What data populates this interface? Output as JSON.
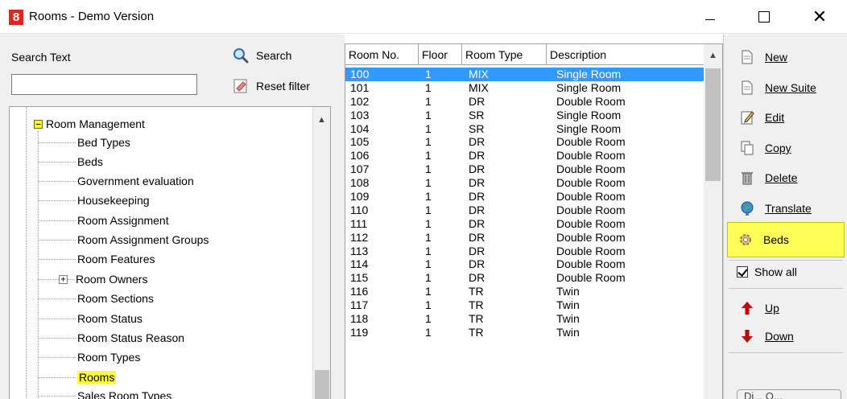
{
  "window": {
    "icon_text": "8",
    "title": "Rooms - Demo Version",
    "controls": {
      "minimize": "minimize",
      "maximize": "maximize",
      "close": "✕"
    }
  },
  "search": {
    "label": "Search Text",
    "value": "",
    "search_button": "Search",
    "reset_button": "Reset filter"
  },
  "tree": {
    "root": "Room Management",
    "root_expander": "−",
    "items": [
      {
        "label": "Bed Types"
      },
      {
        "label": "Beds"
      },
      {
        "label": "Government evaluation"
      },
      {
        "label": "Housekeeping"
      },
      {
        "label": "Room Assignment"
      },
      {
        "label": "Room Assignment Groups"
      },
      {
        "label": "Room Features"
      },
      {
        "label": "Room Owners",
        "expander": "+"
      },
      {
        "label": "Room Sections"
      },
      {
        "label": "Room Status"
      },
      {
        "label": "Room Status Reason"
      },
      {
        "label": "Room Types"
      },
      {
        "label": "Rooms",
        "selected": true
      },
      {
        "label": "Sales Room Types"
      }
    ]
  },
  "grid": {
    "columns": [
      "Room No.",
      "Floor",
      "Room Type",
      "Description"
    ],
    "rows": [
      [
        "100",
        "1",
        "MIX",
        "Single Room"
      ],
      [
        "101",
        "1",
        "MIX",
        "Single Room"
      ],
      [
        "102",
        "1",
        "DR",
        "Double Room"
      ],
      [
        "103",
        "1",
        "SR",
        "Single Room"
      ],
      [
        "104",
        "1",
        "SR",
        "Single Room"
      ],
      [
        "105",
        "1",
        "DR",
        "Double Room"
      ],
      [
        "106",
        "1",
        "DR",
        "Double Room"
      ],
      [
        "107",
        "1",
        "DR",
        "Double Room"
      ],
      [
        "108",
        "1",
        "DR",
        "Double Room"
      ],
      [
        "109",
        "1",
        "DR",
        "Double Room"
      ],
      [
        "110",
        "1",
        "DR",
        "Double Room"
      ],
      [
        "111",
        "1",
        "DR",
        "Double Room"
      ],
      [
        "112",
        "1",
        "DR",
        "Double Room"
      ],
      [
        "113",
        "1",
        "DR",
        "Double Room"
      ],
      [
        "114",
        "1",
        "DR",
        "Double Room"
      ],
      [
        "115",
        "1",
        "DR",
        "Double Room"
      ],
      [
        "116",
        "1",
        "TR",
        "Twin"
      ],
      [
        "117",
        "1",
        "TR",
        "Twin"
      ],
      [
        "118",
        "1",
        "TR",
        "Twin"
      ],
      [
        "119",
        "1",
        "TR",
        "Twin"
      ]
    ],
    "selected_row": 0
  },
  "toolbar": {
    "new": "New",
    "new_suite": "New Suite",
    "edit": "Edit",
    "copy": "Copy",
    "delete": "Delete",
    "translate": "Translate",
    "beds": "Beds",
    "show_all": "Show all",
    "show_all_checked": true,
    "up": "Up",
    "down": "Down",
    "partial": "Di... O..."
  },
  "colors": {
    "selection": "#3399ff",
    "highlight": "#ffff33",
    "app_icon": "#e0261b",
    "up_arrow": "#c00000",
    "down_arrow": "#c00000"
  }
}
